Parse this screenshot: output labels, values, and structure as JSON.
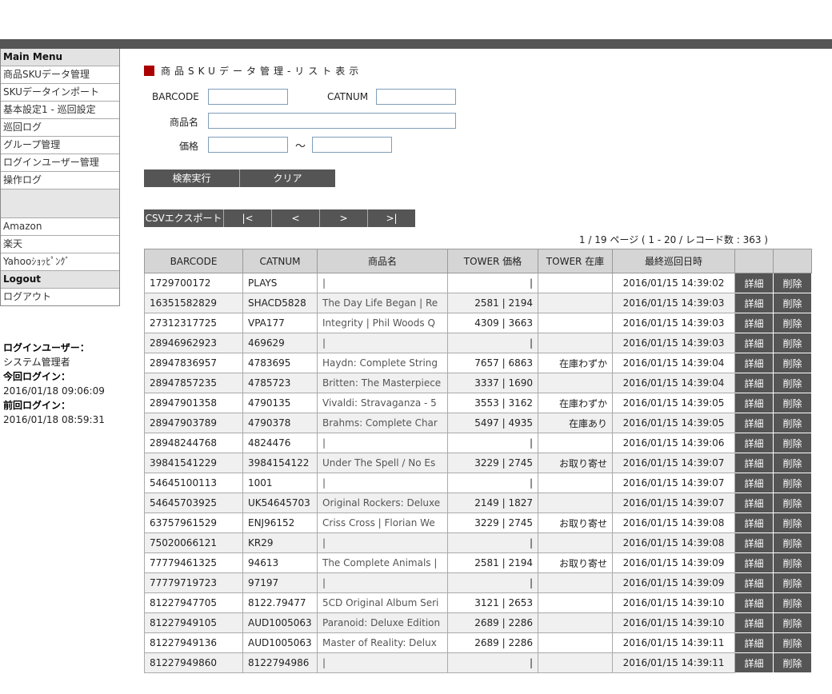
{
  "sidebar": {
    "main_menu_header": "Main Menu",
    "items": [
      "商品SKUデータ管理",
      "SKUデータインポート",
      "基本設定1 - 巡回設定",
      "巡回ログ",
      "グループ管理",
      "ログインユーザー管理",
      "操作ログ"
    ],
    "channel_items": [
      "Amazon",
      "楽天",
      "Yahooｼｮｯﾋﾟﾝｸﾞ"
    ],
    "logout_header": "Logout",
    "logout_item": "ログアウト"
  },
  "login_info": {
    "user_label": "ログインユーザー：",
    "user_name": "システム管理者",
    "current_label": "今回ログイン：",
    "current_time": "2016/01/18 09:06:09",
    "previous_label": "前回ログイン：",
    "previous_time": "2016/01/18 08:59:31"
  },
  "page_title": "商品SKUデータ管理-リスト表示",
  "search": {
    "barcode_label": "BARCODE",
    "catnum_label": "CATNUM",
    "name_label": "商品名",
    "price_label": "価格",
    "range_sep": "～",
    "barcode_value": "",
    "catnum_value": "",
    "name_value": "",
    "price_from_value": "",
    "price_to_value": "",
    "search_button": "検索実行",
    "clear_button": "クリア"
  },
  "pager": {
    "csv_button": "CSVエクスポート",
    "first_button": "|<",
    "prev_button": "<",
    "next_button": ">",
    "last_button": ">|",
    "info": "1 / 19 ページ ( 1 - 20 / レコード数 : 363 )"
  },
  "table": {
    "columns": [
      "BARCODE",
      "CATNUM",
      "商品名",
      "TOWER 価格",
      "TOWER 在庫",
      "最終巡回日時",
      "",
      ""
    ],
    "detail_label": "詳細",
    "delete_label": "削除",
    "rows": [
      {
        "barcode": "1729700172",
        "catnum": "PLAYS",
        "name": "|",
        "price": "|",
        "stock": "",
        "date": "2016/01/15 14:39:02"
      },
      {
        "barcode": "16351582829",
        "catnum": "SHACD5828",
        "name": "The Day Life Began | Re",
        "price": "2581 | 2194",
        "stock": "",
        "date": "2016/01/15 14:39:03"
      },
      {
        "barcode": "27312317725",
        "catnum": "VPA177",
        "name": "Integrity | Phil Woods Q",
        "price": "4309 | 3663",
        "stock": "",
        "date": "2016/01/15 14:39:03"
      },
      {
        "barcode": "28946962923",
        "catnum": "469629",
        "name": "|",
        "price": "|",
        "stock": "",
        "date": "2016/01/15 14:39:03"
      },
      {
        "barcode": "28947836957",
        "catnum": "4783695",
        "name": "Haydn: Complete String",
        "price": "7657 | 6863",
        "stock": "在庫わずか",
        "date": "2016/01/15 14:39:04"
      },
      {
        "barcode": "28947857235",
        "catnum": "4785723",
        "name": "Britten: The Masterpiece",
        "price": "3337 | 1690",
        "stock": "",
        "date": "2016/01/15 14:39:04"
      },
      {
        "barcode": "28947901358",
        "catnum": "4790135",
        "name": "Vivaldi: Stravaganza - 5",
        "price": "3553 | 3162",
        "stock": "在庫わずか",
        "date": "2016/01/15 14:39:05"
      },
      {
        "barcode": "28947903789",
        "catnum": "4790378",
        "name": "Brahms: Complete Char",
        "price": "5497 | 4935",
        "stock": "在庫あり",
        "date": "2016/01/15 14:39:05"
      },
      {
        "barcode": "28948244768",
        "catnum": "4824476",
        "name": "|",
        "price": "|",
        "stock": "",
        "date": "2016/01/15 14:39:06"
      },
      {
        "barcode": "39841541229",
        "catnum": "3984154122",
        "name": "Under The Spell / No Es",
        "price": "3229 | 2745",
        "stock": "お取り寄せ",
        "date": "2016/01/15 14:39:07"
      },
      {
        "barcode": "54645100113",
        "catnum": "1001",
        "name": "|",
        "price": "|",
        "stock": "",
        "date": "2016/01/15 14:39:07"
      },
      {
        "barcode": "54645703925",
        "catnum": "UK54645703",
        "name": "Original Rockers: Deluxe",
        "price": "2149 | 1827",
        "stock": "",
        "date": "2016/01/15 14:39:07"
      },
      {
        "barcode": "63757961529",
        "catnum": "ENJ96152",
        "name": "Criss Cross | Florian We",
        "price": "3229 | 2745",
        "stock": "お取り寄せ",
        "date": "2016/01/15 14:39:08"
      },
      {
        "barcode": "75020066121",
        "catnum": "KR29",
        "name": "|",
        "price": "|",
        "stock": "",
        "date": "2016/01/15 14:39:08"
      },
      {
        "barcode": "77779461325",
        "catnum": "94613",
        "name": "The Complete Animals |",
        "price": "2581 | 2194",
        "stock": "お取り寄せ",
        "date": "2016/01/15 14:39:09"
      },
      {
        "barcode": "77779719723",
        "catnum": "97197",
        "name": "|",
        "price": "|",
        "stock": "",
        "date": "2016/01/15 14:39:09"
      },
      {
        "barcode": "81227947705",
        "catnum": "8122.79477",
        "name": "5CD Original Album Seri",
        "price": "3121 | 2653",
        "stock": "",
        "date": "2016/01/15 14:39:10"
      },
      {
        "barcode": "81227949105",
        "catnum": "AUD1005063",
        "name": "Paranoid: Deluxe Edition",
        "price": "2689 | 2286",
        "stock": "",
        "date": "2016/01/15 14:39:10"
      },
      {
        "barcode": "81227949136",
        "catnum": "AUD1005063",
        "name": "Master of Reality: Delux",
        "price": "2689 | 2286",
        "stock": "",
        "date": "2016/01/15 14:39:11"
      },
      {
        "barcode": "81227949860",
        "catnum": "8122794986",
        "name": "|",
        "price": "|",
        "stock": "",
        "date": "2016/01/15 14:39:11"
      }
    ]
  }
}
